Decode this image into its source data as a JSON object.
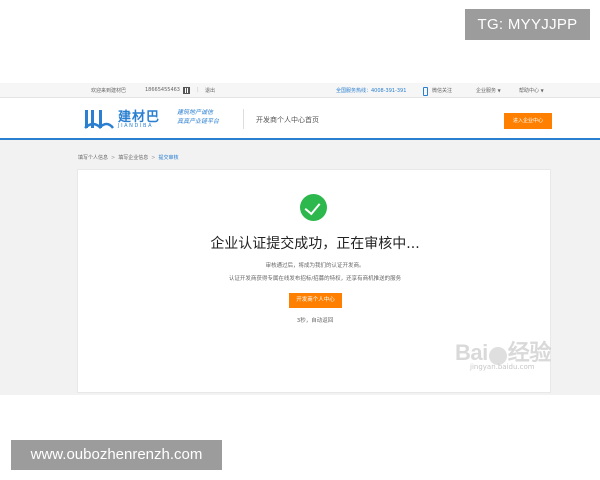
{
  "overlays": {
    "tg_label": "TG: MYYJJPP",
    "url_label": "www.oubozhenrenzh.com",
    "baidu_watermark": "Bai",
    "baidu_watermark_cn": "经验",
    "baidu_watermark_sub": "jingyan.baidu.com"
  },
  "topbar": {
    "welcome": "欢迎来到建材巴",
    "phone": "18665455463",
    "logout": "退出",
    "hotline": "全国服务热线：4008-391-391",
    "wechat": "微信关注",
    "enterprise": "企业服务",
    "help": "帮助中心"
  },
  "header": {
    "logo_cn": "建材巴",
    "logo_pinyin": "JIANDIBA",
    "slogan_line1": "建筑地产诚信",
    "slogan_line2": "真真产业链平台",
    "title": "开发商个人中心首页",
    "enter_button": "进入企业中心"
  },
  "breadcrumb": {
    "items": [
      "填写个人信息",
      "填写企业信息",
      "提交审核"
    ]
  },
  "status": {
    "title": "企业认证提交成功，正在审核中...",
    "line1": "审核通过后，将成为我们的认证开发商。",
    "line2": "认证开发商获得专属在线发布招标/招募的特权，还享有商机推送的服务",
    "button": "开发商个人中心",
    "redirect_note": "3秒，自动返回"
  },
  "colors": {
    "accent": "#ff7f00",
    "brand": "#2a7fd0",
    "success": "#2db84d"
  }
}
